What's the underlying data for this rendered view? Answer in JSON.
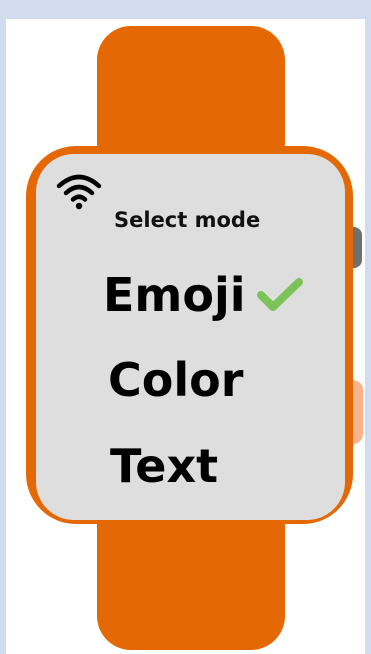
{
  "watch": {
    "heading": "Select mode",
    "options": [
      {
        "label": "Emoji",
        "selected": true
      },
      {
        "label": "Color",
        "selected": false
      },
      {
        "label": "Text",
        "selected": false
      }
    ]
  },
  "icons": {
    "wifi": "wifi-icon",
    "selected_marker": "checkmark-icon"
  },
  "colors": {
    "strap": "#e46804",
    "screen": "#dedede",
    "checkmark": "#7cc35a",
    "side_button": "#707070",
    "side_pad": "#f6b58c",
    "background": "#d3dbee"
  }
}
